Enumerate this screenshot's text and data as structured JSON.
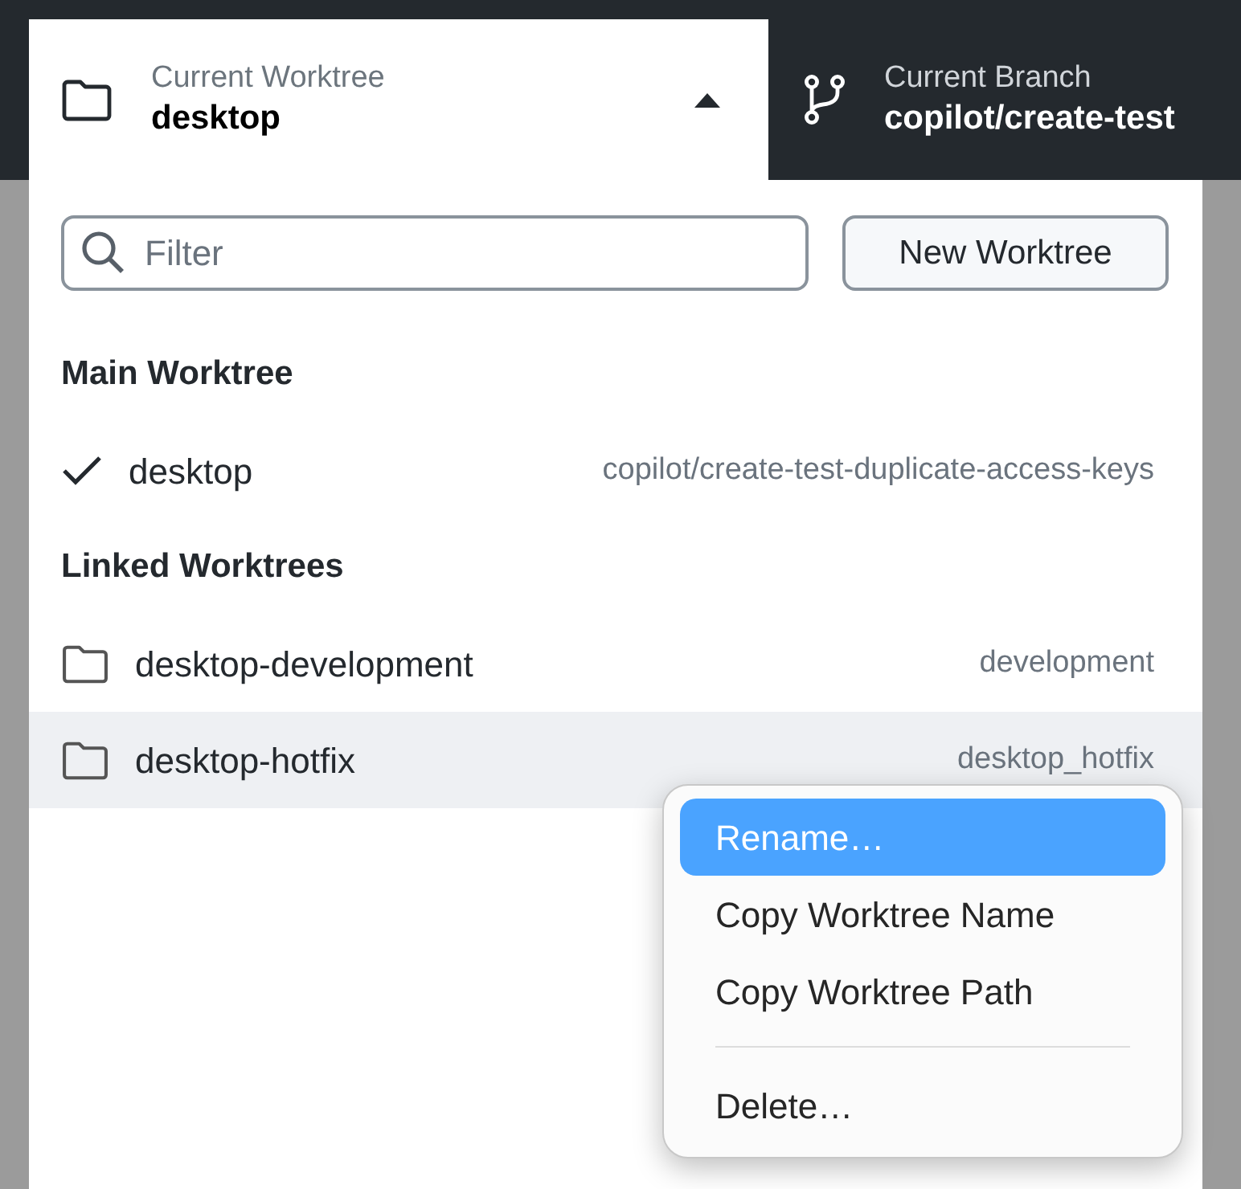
{
  "worktree_button": {
    "label": "Current Worktree",
    "value": "desktop",
    "expanded": true
  },
  "branch_button": {
    "label": "Current Branch",
    "value": "copilot/create-test"
  },
  "filter": {
    "placeholder": "Filter"
  },
  "new_worktree_button": "New Worktree",
  "sections": [
    {
      "heading": "Main Worktree",
      "items": [
        {
          "name": "desktop",
          "branch": "copilot/create-test-duplicate-access-keys",
          "current": true,
          "selected": false
        }
      ]
    },
    {
      "heading": "Linked Worktrees",
      "items": [
        {
          "name": "desktop-development",
          "branch": "development",
          "current": false,
          "selected": false
        },
        {
          "name": "desktop-hotfix",
          "branch": "desktop_hotfix",
          "current": false,
          "selected": true
        }
      ]
    }
  ],
  "context_menu": [
    {
      "kind": "item",
      "label": "Rename…",
      "selected": true
    },
    {
      "kind": "item",
      "label": "Copy Worktree Name",
      "selected": false
    },
    {
      "kind": "item",
      "label": "Copy Worktree Path",
      "selected": false
    },
    {
      "kind": "separator"
    },
    {
      "kind": "item",
      "label": "Delete…",
      "selected": false
    }
  ]
}
